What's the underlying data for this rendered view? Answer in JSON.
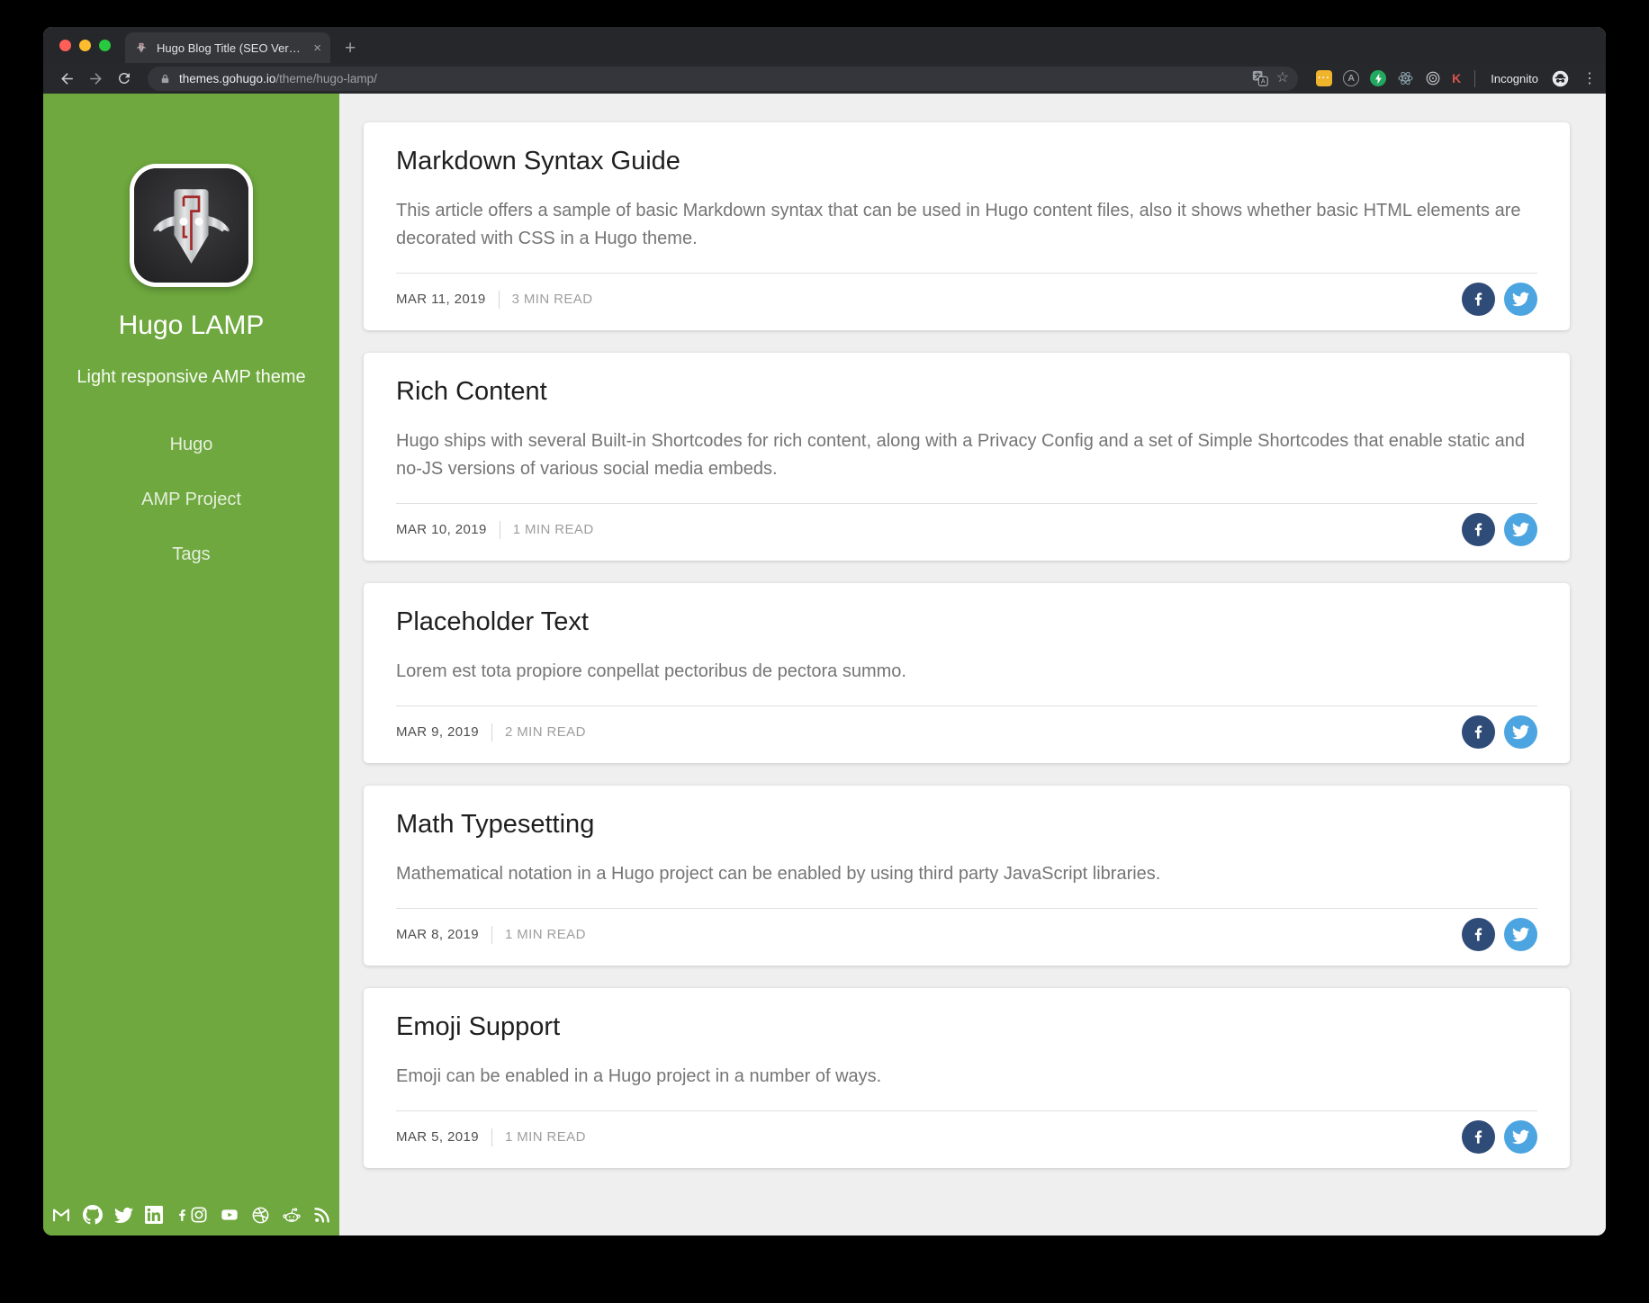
{
  "browser": {
    "tab_title": "Hugo Blog Title (SEO Version)",
    "close_tab_label": "×",
    "new_tab_label": "+",
    "url_host": "themes.gohugo.io",
    "url_path": "/theme/hugo-lamp/",
    "incognito_label": "Incognito",
    "kebab_label": "⋮",
    "bookmark_star": "☆",
    "extension_dots": "···",
    "extension_a": "A",
    "extension_k": "K",
    "toolbar_icons": [
      "back-icon",
      "forward-icon",
      "reload-icon",
      "lock-icon",
      "translate-icon",
      "bookmark-star-icon",
      "yellow-dots-extension-icon",
      "amp-a-extension-icon",
      "amp-lightning-extension-icon",
      "react-devtools-icon",
      "target-extension-icon",
      "k-extension-icon",
      "incognito-icon",
      "kebab-menu-icon"
    ]
  },
  "sidebar": {
    "title": "Hugo LAMP",
    "tagline": "Light responsive AMP theme",
    "nav": [
      {
        "label": "Hugo"
      },
      {
        "label": "AMP Project"
      },
      {
        "label": "Tags"
      }
    ],
    "social_icons": [
      "gmail",
      "github",
      "twitter",
      "linkedin",
      "facebook",
      "instagram",
      "youtube",
      "dribbble",
      "reddit",
      "rss"
    ]
  },
  "posts": [
    {
      "title": "Markdown Syntax Guide",
      "excerpt": "This article offers a sample of basic Markdown syntax that can be used in Hugo content files, also it shows whether basic HTML elements are decorated with CSS in a Hugo theme.",
      "date": "MAR 11, 2019",
      "read_time": "3 MIN READ"
    },
    {
      "title": "Rich Content",
      "excerpt": "Hugo ships with several Built-in Shortcodes for rich content, along with a Privacy Config and a set of Simple Shortcodes that enable static and no-JS versions of various social media embeds.",
      "date": "MAR 10, 2019",
      "read_time": "1 MIN READ"
    },
    {
      "title": "Placeholder Text",
      "excerpt": "Lorem est tota propiore conpellat pectoribus de pectora summo.",
      "date": "MAR 9, 2019",
      "read_time": "2 MIN READ"
    },
    {
      "title": "Math Typesetting",
      "excerpt": "Mathematical notation in a Hugo project can be enabled by using third party JavaScript libraries.",
      "date": "MAR 8, 2019",
      "read_time": "1 MIN READ"
    },
    {
      "title": "Emoji Support",
      "excerpt": "Emoji can be enabled in a Hugo project in a number of ways.",
      "date": "MAR 5, 2019",
      "read_time": "1 MIN READ"
    }
  ],
  "share": {
    "facebook_icon": "facebook-share",
    "twitter_icon": "twitter-share"
  },
  "colors": {
    "accent_green": "#6ea83e",
    "facebook_share": "#2f4b77",
    "twitter_share": "#4ca5e0",
    "content_bg": "#efefef",
    "card_bg": "#ffffff"
  }
}
